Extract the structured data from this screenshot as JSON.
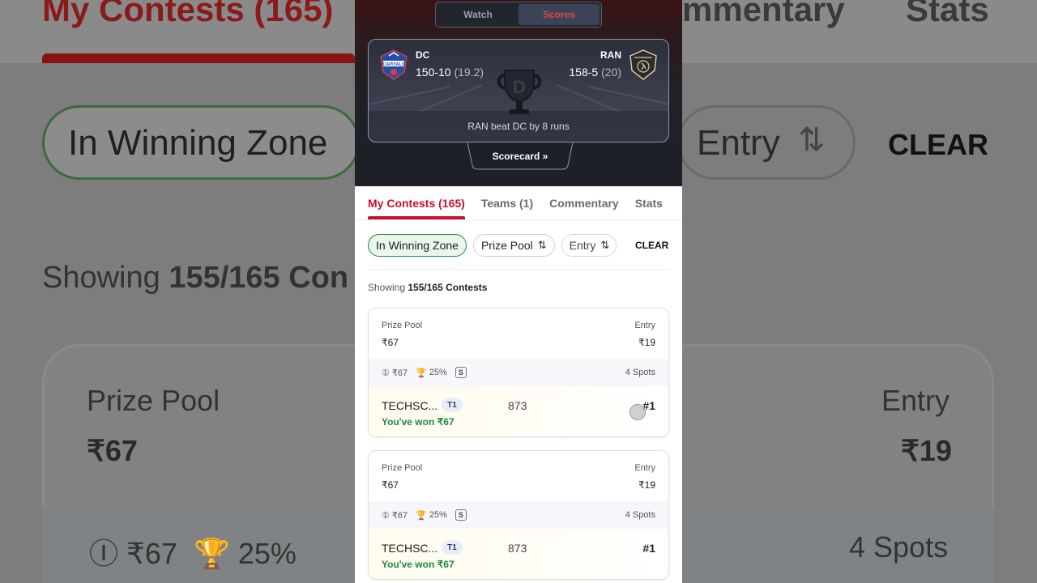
{
  "toggle": {
    "watch": "Watch",
    "scores": "Scores"
  },
  "match": {
    "team1": {
      "code": "DC",
      "score": "150-10",
      "overs": "(19.2)"
    },
    "team2": {
      "code": "RAN",
      "score": "158-5",
      "overs": "(20)"
    },
    "result": "RAN beat DC by 8 runs",
    "scorecard_label": "Scorecard"
  },
  "tabs": [
    {
      "label": "My Contests (165)"
    },
    {
      "label": "Teams (1)"
    },
    {
      "label": "Commentary"
    },
    {
      "label": "Stats"
    }
  ],
  "filters": {
    "winning_zone": "In Winning Zone",
    "prize_pool": "Prize Pool",
    "entry": "Entry",
    "clear": "CLEAR"
  },
  "showing": {
    "prefix": "Showing",
    "count": "155/165 Contests"
  },
  "contests": [
    {
      "prize_label": "Prize Pool",
      "prize": "₹67",
      "entry_label": "Entry",
      "entry": "₹19",
      "first_prize": "₹67",
      "winners": "25%",
      "spots": "4 Spots",
      "team": "TECHSC...",
      "team_tag": "T1",
      "points": "873",
      "rank": "#1",
      "won": "You've won ₹67"
    },
    {
      "prize_label": "Prize Pool",
      "prize": "₹67",
      "entry_label": "Entry",
      "entry": "₹19",
      "first_prize": "₹67",
      "winners": "25%",
      "spots": "4 Spots",
      "team": "TECHSC...",
      "team_tag": "T1",
      "points": "873",
      "rank": "#1",
      "won": "You've won ₹67"
    }
  ],
  "background": {
    "title": "My Contests (165)",
    "commentary": "mmentary",
    "stats": "Stats",
    "chip": "In Winning Zone",
    "entry": "Entry",
    "clear": "CLEAR",
    "showing_prefix": "Showing",
    "showing_count": "155/165 Con",
    "prize_label": "Prize Pool",
    "prize": "₹67",
    "entry_label": "Entry",
    "entry_val": "₹19",
    "first": "₹67",
    "pct": "25%",
    "spots": "4 Spots"
  },
  "colors": {
    "accent": "#c8102e",
    "success": "#1e8a3e",
    "header": "#1e2128"
  }
}
